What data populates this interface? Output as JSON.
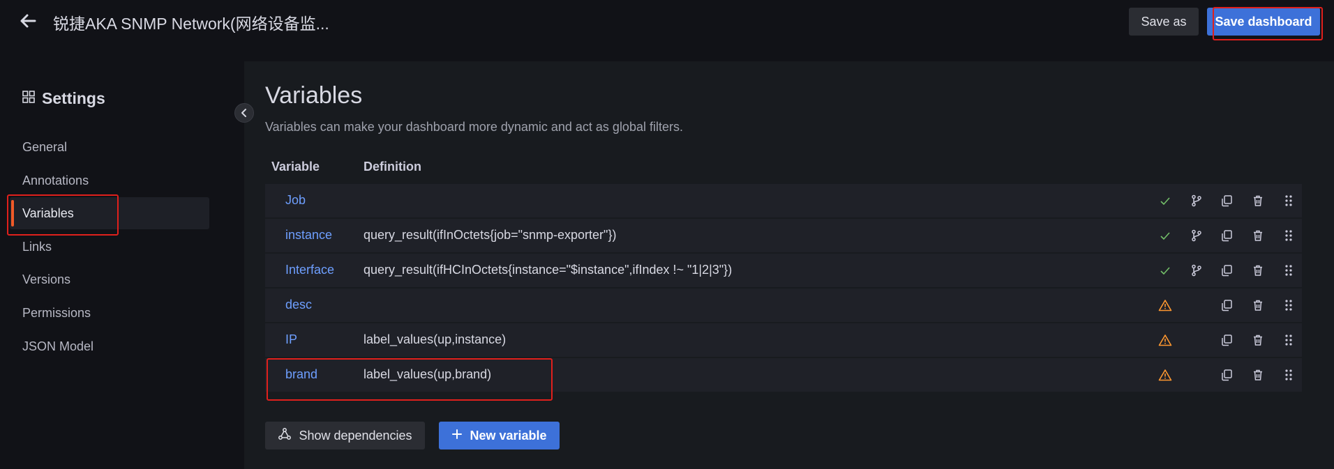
{
  "header": {
    "title": "锐捷AKA SNMP Network(网络设备监...",
    "save_as_label": "Save as",
    "save_dashboard_label": "Save dashboard"
  },
  "sidebar": {
    "title": "Settings",
    "items": [
      {
        "label": "General"
      },
      {
        "label": "Annotations"
      },
      {
        "label": "Variables",
        "active": true
      },
      {
        "label": "Links"
      },
      {
        "label": "Versions"
      },
      {
        "label": "Permissions"
      },
      {
        "label": "JSON Model"
      }
    ]
  },
  "main": {
    "title": "Variables",
    "subtitle": "Variables can make your dashboard more dynamic and act as global filters.",
    "columns": {
      "variable": "Variable",
      "definition": "Definition"
    },
    "rows": [
      {
        "name": "Job",
        "definition": "",
        "status": "check"
      },
      {
        "name": "instance",
        "definition": "query_result(ifInOctets{job=\"snmp-exporter\"})",
        "status": "check"
      },
      {
        "name": "Interface",
        "definition": "query_result(ifHCInOctets{instance=\"$instance\",ifIndex !~ \"1|2|3\"})",
        "status": "check"
      },
      {
        "name": "desc",
        "definition": "",
        "status": "warning"
      },
      {
        "name": "IP",
        "definition": "label_values(up,instance)",
        "status": "warning"
      },
      {
        "name": "brand",
        "definition": "label_values(up,brand)",
        "status": "warning"
      }
    ],
    "show_dependencies_label": "Show dependencies",
    "new_variable_label": "New variable"
  },
  "colors": {
    "background": "#111217",
    "panel": "#181b1f",
    "row": "#1f2128",
    "link_blue": "#6e9fff",
    "primary": "#3d71d9",
    "success": "#73bf69",
    "warning": "#ff9830",
    "active_accent": "#f05a28",
    "highlight_box": "#e0201c"
  }
}
